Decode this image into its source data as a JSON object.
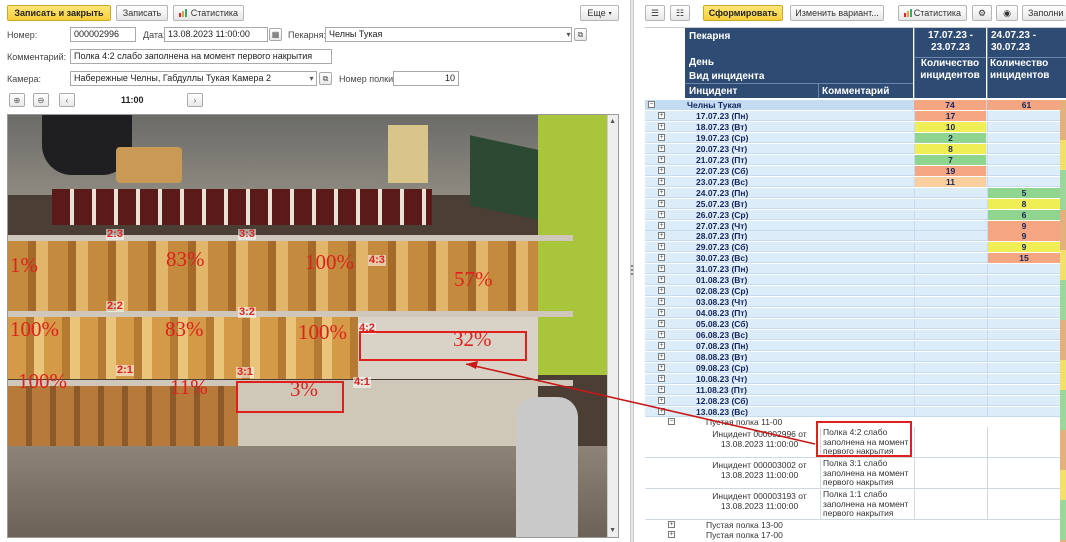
{
  "left_toolbar": {
    "save_close": "Записать и закрыть",
    "save": "Записать",
    "statistics": "Статистика",
    "more": "Еще"
  },
  "form": {
    "number_label": "Номер:",
    "number_value": "000002996",
    "date_label": "Дата:",
    "date_value": "13.08.2023 11:00:00",
    "bakery_label": "Пекарня:",
    "bakery_value": "Челны Тукая",
    "comment_label": "Комментарий:",
    "comment_value": "Полка 4:2 слабо заполнена на момент первого накрытия",
    "camera_label": "Камера:",
    "camera_value": "Набережные Челны, Габдуллы Тукая Камера 2",
    "shelf_label": "Номер полки:",
    "shelf_value": "10"
  },
  "viewer": {
    "time": "11:00",
    "prev": "‹",
    "next": "›"
  },
  "shelves": [
    {
      "label": "2:3",
      "pct": "1%"
    },
    {
      "label": "",
      "pct": "83%"
    },
    {
      "label": "3:3",
      "pct": "100%"
    },
    {
      "label": "4:3",
      "pct": "57%"
    },
    {
      "label": "2:2",
      "pct": "100%"
    },
    {
      "label": "3:2",
      "pct": "83%"
    },
    {
      "label": "",
      "pct": "100%"
    },
    {
      "label": "4:2",
      "pct": "32%"
    },
    {
      "label": "2:1",
      "pct": "100%"
    },
    {
      "label": "3:1",
      "pct": "11%"
    },
    {
      "label": "",
      "pct": "3%"
    },
    {
      "label": "4:1",
      "pct": ""
    }
  ],
  "right_toolbar": {
    "generate": "Сформировать",
    "change_variant": "Изменить вариант...",
    "statistics": "Статистика",
    "fill": "Заполни"
  },
  "report": {
    "h_bakery": "Пекарня",
    "h_day": "День",
    "h_type": "Вид инцидента",
    "h_incident": "Инцидент",
    "h_comment": "Комментарий",
    "h_period1": "17.07.23 - 23.07.23",
    "h_period2": "24.07.23 - 30.07.23",
    "h_count1": "Количество инцидентов",
    "h_count2": "Количество инцидентов",
    "group_name": "Челны Тукая",
    "group_total1": "74",
    "group_total2": "61",
    "days": [
      {
        "d": "17.07.23 (Пн)",
        "v1": "17",
        "c1": "#f4a582",
        "v2": "",
        "c2": ""
      },
      {
        "d": "18.07.23 (Вт)",
        "v1": "10",
        "c1": "#f0ee55",
        "v2": "",
        "c2": ""
      },
      {
        "d": "19.07.23 (Ср)",
        "v1": "2",
        "c1": "#8fd48f",
        "v2": "",
        "c2": ""
      },
      {
        "d": "20.07.23 (Чт)",
        "v1": "8",
        "c1": "#f0ee55",
        "v2": "",
        "c2": ""
      },
      {
        "d": "21.07.23 (Пт)",
        "v1": "7",
        "c1": "#8fd48f",
        "v2": "",
        "c2": ""
      },
      {
        "d": "22.07.23 (Сб)",
        "v1": "19",
        "c1": "#f4a582",
        "v2": "",
        "c2": ""
      },
      {
        "d": "23.07.23 (Вс)",
        "v1": "11",
        "c1": "#f9cfa0",
        "v2": "",
        "c2": ""
      },
      {
        "d": "24.07.23 (Пн)",
        "v1": "",
        "c1": "",
        "v2": "5",
        "c2": "#8fd48f"
      },
      {
        "d": "25.07.23 (Вт)",
        "v1": "",
        "c1": "",
        "v2": "8",
        "c2": "#f0ee55"
      },
      {
        "d": "26.07.23 (Ср)",
        "v1": "",
        "c1": "",
        "v2": "6",
        "c2": "#8fd48f"
      },
      {
        "d": "27.07.23 (Чт)",
        "v1": "",
        "c1": "",
        "v2": "9",
        "c2": "#f4a582"
      },
      {
        "d": "28.07.23 (Пт)",
        "v1": "",
        "c1": "",
        "v2": "9",
        "c2": "#f4a582"
      },
      {
        "d": "29.07.23 (Сб)",
        "v1": "",
        "c1": "",
        "v2": "9",
        "c2": "#f0ee55"
      },
      {
        "d": "30.07.23 (Вс)",
        "v1": "",
        "c1": "",
        "v2": "15",
        "c2": "#f4a582"
      },
      {
        "d": "31.07.23 (Пн)",
        "v1": "",
        "c1": "",
        "v2": "",
        "c2": ""
      },
      {
        "d": "01.08.23 (Вт)",
        "v1": "",
        "c1": "",
        "v2": "",
        "c2": ""
      },
      {
        "d": "02.08.23 (Ср)",
        "v1": "",
        "c1": "",
        "v2": "",
        "c2": ""
      },
      {
        "d": "03.08.23 (Чт)",
        "v1": "",
        "c1": "",
        "v2": "",
        "c2": ""
      },
      {
        "d": "04.08.23 (Пт)",
        "v1": "",
        "c1": "",
        "v2": "",
        "c2": ""
      },
      {
        "d": "05.08.23 (Сб)",
        "v1": "",
        "c1": "",
        "v2": "",
        "c2": ""
      },
      {
        "d": "06.08.23 (Вс)",
        "v1": "",
        "c1": "",
        "v2": "",
        "c2": ""
      },
      {
        "d": "07.08.23 (Пн)",
        "v1": "",
        "c1": "",
        "v2": "",
        "c2": ""
      },
      {
        "d": "08.08.23 (Вт)",
        "v1": "",
        "c1": "",
        "v2": "",
        "c2": ""
      },
      {
        "d": "09.08.23 (Ср)",
        "v1": "",
        "c1": "",
        "v2": "",
        "c2": ""
      },
      {
        "d": "10.08.23 (Чт)",
        "v1": "",
        "c1": "",
        "v2": "",
        "c2": ""
      },
      {
        "d": "11.08.23 (Пт)",
        "v1": "",
        "c1": "",
        "v2": "",
        "c2": ""
      },
      {
        "d": "12.08.23 (Сб)",
        "v1": "",
        "c1": "",
        "v2": "",
        "c2": ""
      },
      {
        "d": "13.08.23 (Вс)",
        "v1": "",
        "c1": "",
        "v2": "",
        "c2": ""
      }
    ],
    "sub_group": "Пустая полка 11-00",
    "incidents": [
      {
        "name": "Инцидент 000002996 от 13.08.2023 11:00:00",
        "comment": "Полка 4:2 слабо заполнена на момент первого накрытия"
      },
      {
        "name": "Инцидент 000003002 от 13.08.2023 11:00:00",
        "comment": "Полка 3:1 слабо заполнена на момент первого накрытия"
      },
      {
        "name": "Инцидент 000003193 от 13.08.2023 11:00:00",
        "comment": "Полка 1:1 слабо заполнена на момент первого накрытия"
      }
    ],
    "tail_groups": [
      "Пустая полка 13-00",
      "Пустая полка 17-00"
    ]
  },
  "colors": {
    "header_bg": "#2e4b73",
    "row_bg": "#dcecf8",
    "accent_yellow": "#f5cf3a",
    "annotation_red": "#e0201c"
  }
}
